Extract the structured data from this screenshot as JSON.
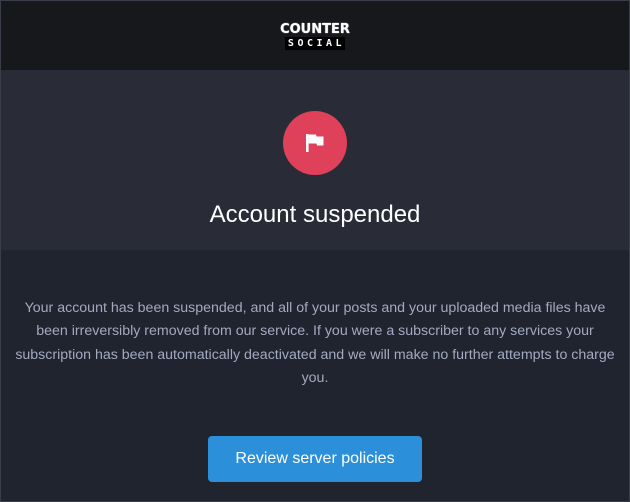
{
  "header": {
    "logo_line1": "COUNTER",
    "logo_line2": "SOCIAL"
  },
  "hero": {
    "icon": "flag-icon",
    "title": "Account suspended"
  },
  "main": {
    "message": "Your account has been suspended, and all of your posts and your uploaded media files have been irreversibly removed from our service. If you were a subscriber to any services your subscription has been automatically deactivated and we will make no further attempts to charge you.",
    "button_label": "Review server policies"
  },
  "colors": {
    "top_bar": "#17181c",
    "hero_bg": "#292c37",
    "page_bg": "#20242f",
    "flag_circle": "#df405a",
    "button": "#2b90d9",
    "message_text": "#a3aac0"
  }
}
